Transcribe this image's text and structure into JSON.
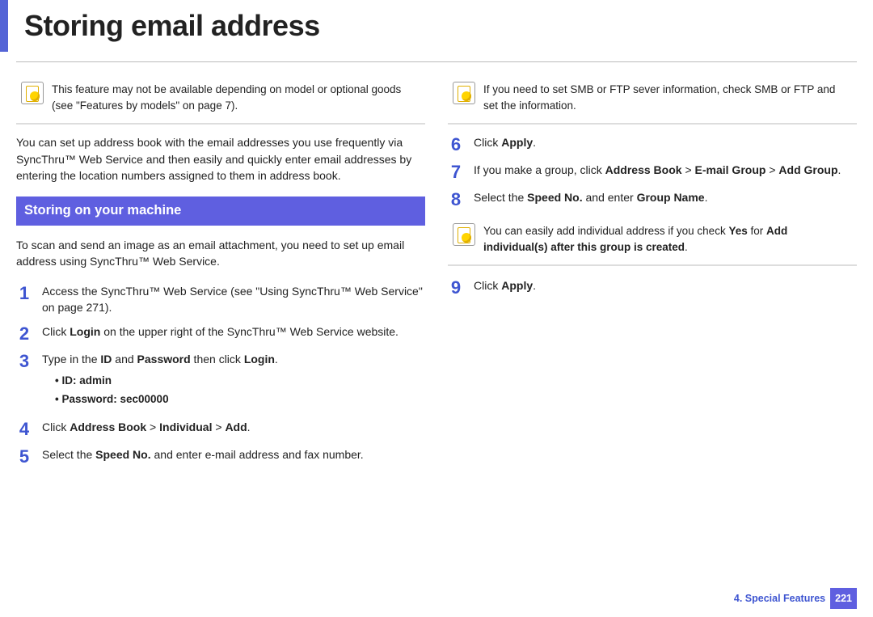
{
  "title": "Storing email address",
  "left": {
    "note1": "This feature may not be available depending on model or optional goods (see \"Features by models\" on page 7).",
    "intro": "You can set up address book with the email addresses you use frequently via SyncThru™ Web Service and then easily and quickly enter email addresses by entering the location numbers assigned to them in address book.",
    "sectionTitle": "Storing on your machine",
    "sectionIntro": "To scan and send an image as an email attachment, you need to set up email address using SyncThru™ Web Service.",
    "step1": "Access the SyncThru™ Web Service (see \"Using SyncThru™ Web Service\" on page 271).",
    "step2_a": "Click ",
    "step2_b": "Login",
    "step2_c": " on the upper right of the SyncThru™ Web Service website.",
    "step3_a": "Type in the ",
    "step3_b": "ID",
    "step3_c": " and ",
    "step3_d": "Password",
    "step3_e": " then click ",
    "step3_f": "Login",
    "step3_g": ".",
    "step3_id": "ID: admin",
    "step3_pw": "Password: sec00000",
    "step4_a": "Click ",
    "step4_b": "Address Book",
    "step4_c": " > ",
    "step4_d": "Individual",
    "step4_e": " > ",
    "step4_f": "Add",
    "step4_g": ".",
    "step5_a": "Select the ",
    "step5_b": "Speed No.",
    "step5_c": " and enter e-mail address and fax number."
  },
  "right": {
    "note1": "If you need to set SMB or FTP sever information, check SMB or FTP and set the information.",
    "step6_a": "Click ",
    "step6_b": "Apply",
    "step6_c": ".",
    "step7_a": "If you make a group, click ",
    "step7_b": "Address Book",
    "step7_c": " > ",
    "step7_d": "E-mail Group",
    "step7_e": " > ",
    "step7_f": "Add Group",
    "step7_g": ".",
    "step8_a": "Select the ",
    "step8_b": "Speed No.",
    "step8_c": " and enter ",
    "step8_d": "Group Name",
    "step8_e": ".",
    "note2_a": "You can easily add individual address if you check ",
    "note2_b": "Yes",
    "note2_c": " for ",
    "note2_d": "Add individual(s) after this group is created",
    "note2_e": ".",
    "step9_a": "Click ",
    "step9_b": "Apply",
    "step9_c": "."
  },
  "footer": {
    "chapter": "4.  Special Features",
    "page": "221"
  }
}
